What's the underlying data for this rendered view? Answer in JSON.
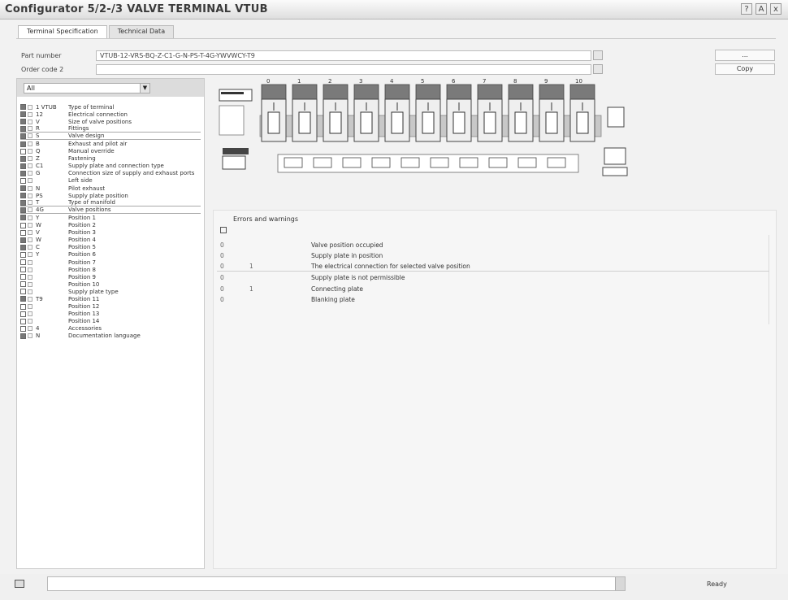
{
  "window": {
    "title": "Configurator 5/2-/3 VALVE TERMINAL VTUB",
    "controls": [
      "?",
      "A",
      "x"
    ]
  },
  "tabs": [
    {
      "label": "Terminal Specification",
      "active": true
    },
    {
      "label": "Technical Data",
      "active": false
    }
  ],
  "fields": [
    {
      "label": "Part number",
      "value": "VTUB-12-VRS-BQ-Z-C1-G-N-PS-T-4G-YWVWCY-T9"
    },
    {
      "label": "Order code 2",
      "value": ""
    }
  ],
  "right_buttons": [
    "...",
    "Copy"
  ],
  "left_panel": {
    "selector": "All",
    "items": [
      {
        "checked": true,
        "code": "1 VTUB",
        "label": "Type of terminal"
      },
      {
        "checked": true,
        "code": "12",
        "label": "Electrical connection"
      },
      {
        "checked": true,
        "code": "V",
        "label": "Size of valve positions"
      },
      {
        "checked": true,
        "code": "R",
        "label": "Fittings"
      },
      {
        "checked": true,
        "code": "S",
        "label": "Valve design"
      },
      {
        "checked": true,
        "code": "B",
        "label": "Exhaust and pilot air"
      },
      {
        "checked": false,
        "code": "Q",
        "label": "Manual override"
      },
      {
        "checked": true,
        "code": "Z",
        "label": "Fastening"
      },
      {
        "checked": true,
        "code": "C1",
        "label": "Supply plate and connection type"
      },
      {
        "checked": true,
        "code": "G",
        "label": "Connection size of supply and exhaust ports"
      },
      {
        "checked": false,
        "code": "",
        "label": "Left side"
      },
      {
        "checked": true,
        "code": "N",
        "label": "Pilot exhaust"
      },
      {
        "checked": true,
        "code": "PS",
        "label": "Supply plate position"
      },
      {
        "checked": true,
        "code": "T",
        "label": "Type of manifold"
      },
      {
        "checked": true,
        "code": "4G",
        "label": "Valve positions"
      },
      {
        "checked": true,
        "code": "Y",
        "label": "Position 1"
      },
      {
        "checked": false,
        "code": "W",
        "label": "Position 2"
      },
      {
        "checked": false,
        "code": "V",
        "label": "Position 3"
      },
      {
        "checked": true,
        "code": "W",
        "label": "Position 4"
      },
      {
        "checked": true,
        "code": "C",
        "label": "Position 5"
      },
      {
        "checked": false,
        "code": "Y",
        "label": "Position 6"
      },
      {
        "checked": false,
        "code": "",
        "label": "Position 7"
      },
      {
        "checked": false,
        "code": "",
        "label": "Position 8"
      },
      {
        "checked": false,
        "code": "",
        "label": "Position 9"
      },
      {
        "checked": false,
        "code": "",
        "label": "Position 10"
      },
      {
        "checked": false,
        "code": "",
        "label": "Supply plate type"
      },
      {
        "checked": true,
        "code": "T9",
        "label": "Position 11"
      },
      {
        "checked": false,
        "code": "",
        "label": "Position 12"
      },
      {
        "checked": false,
        "code": "",
        "label": "Position 13"
      },
      {
        "checked": false,
        "code": "",
        "label": "Position 14"
      },
      {
        "checked": false,
        "code": "4",
        "label": "Accessories"
      },
      {
        "checked": true,
        "code": "N",
        "label": "Documentation language"
      }
    ]
  },
  "diagram": {
    "position_labels": [
      "0",
      "1",
      "2",
      "3",
      "4",
      "5",
      "6",
      "7",
      "8",
      "9",
      "10"
    ]
  },
  "messages": {
    "title": "Errors and warnings",
    "rows": [
      {
        "c1": "0",
        "c2": "",
        "text": "Valve position occupied"
      },
      {
        "c1": "0",
        "c2": "",
        "text": "Supply plate in position"
      },
      {
        "c1": "0",
        "c2": "1",
        "text": "The electrical connection for selected valve position"
      },
      {
        "c1": "0",
        "c2": "",
        "text": "Supply plate is not permissible"
      },
      {
        "c1": "0",
        "c2": "1",
        "text": "Connecting plate"
      },
      {
        "c1": "0",
        "c2": "",
        "text": "Blanking plate"
      }
    ]
  },
  "status": {
    "text": "Ready"
  }
}
